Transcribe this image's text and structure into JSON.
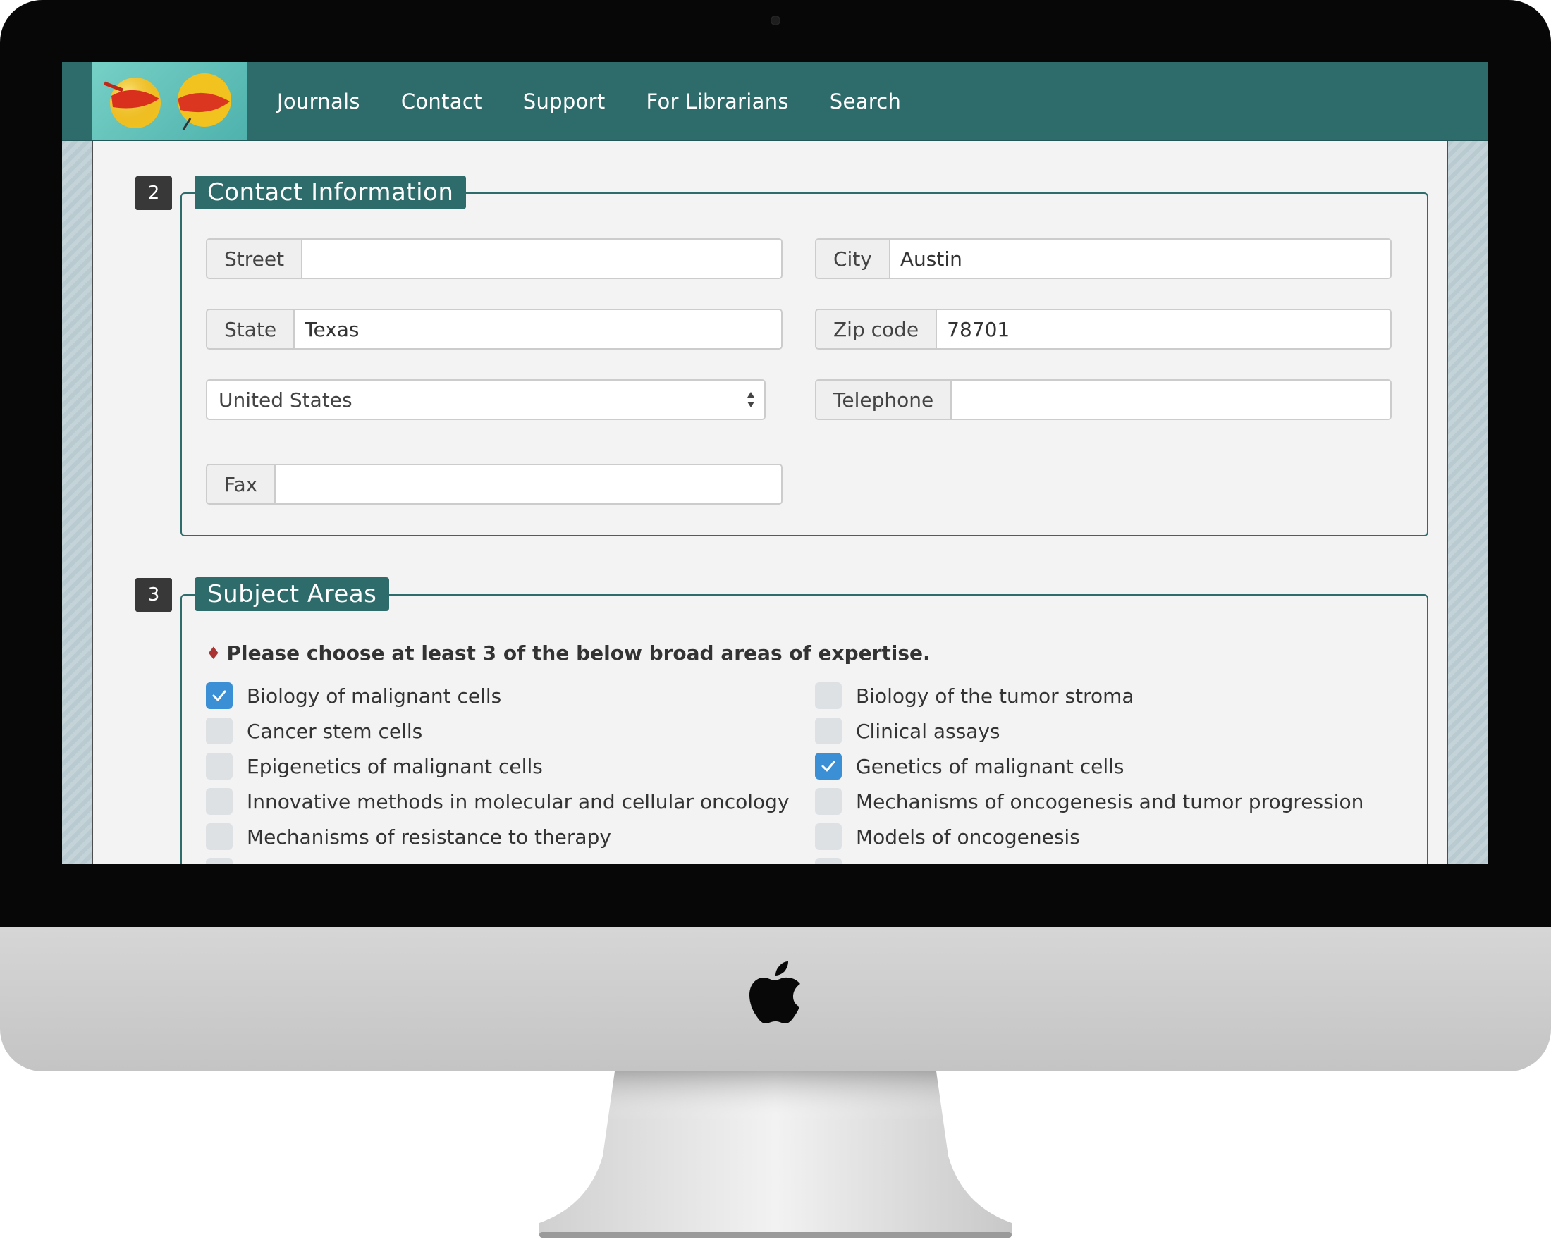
{
  "nav": {
    "items": [
      {
        "label": "Journals"
      },
      {
        "label": "Contact"
      },
      {
        "label": "Support"
      },
      {
        "label": "For Librarians"
      },
      {
        "label": "Search"
      }
    ]
  },
  "contact": {
    "step": "2",
    "title": "Contact Information",
    "street": {
      "label": "Street",
      "value": ""
    },
    "city": {
      "label": "City",
      "value": "Austin"
    },
    "state": {
      "label": "State",
      "value": "Texas"
    },
    "zip": {
      "label": "Zip code",
      "value": "78701"
    },
    "country": {
      "value": "United States"
    },
    "telephone": {
      "label": "Telephone",
      "value": ""
    },
    "fax": {
      "label": "Fax",
      "value": ""
    }
  },
  "subjects": {
    "step": "3",
    "title": "Subject Areas",
    "instruction": "Please choose at least 3 of the below broad areas of expertise.",
    "items": [
      {
        "label": "Biology of malignant cells",
        "checked": true
      },
      {
        "label": "Biology of the tumor stroma",
        "checked": false
      },
      {
        "label": "Cancer stem cells",
        "checked": false
      },
      {
        "label": "Clinical assays",
        "checked": false
      },
      {
        "label": "Epigenetics of malignant cells",
        "checked": false
      },
      {
        "label": "Genetics of malignant cells",
        "checked": true
      },
      {
        "label": "Innovative methods in molecular and cellular oncology",
        "checked": false
      },
      {
        "label": "Mechanisms of oncogenesis and tumor progression",
        "checked": false
      },
      {
        "label": "Mechanisms of resistance to therapy",
        "checked": false
      },
      {
        "label": "Models of oncogenesis",
        "checked": false
      }
    ]
  },
  "colors": {
    "accent": "#2e6b6b",
    "checked": "#3b8fd4"
  }
}
